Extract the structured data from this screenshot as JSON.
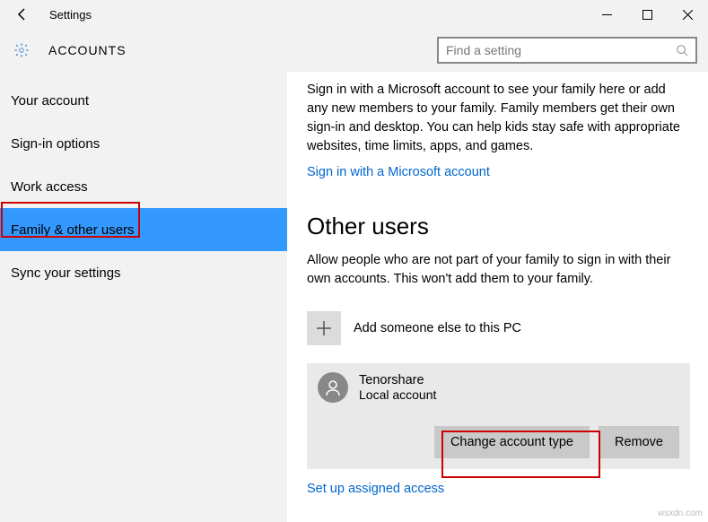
{
  "window": {
    "title": "Settings"
  },
  "header": {
    "section": "ACCOUNTS"
  },
  "search": {
    "placeholder": "Find a setting"
  },
  "sidebar": {
    "items": [
      {
        "label": "Your account"
      },
      {
        "label": "Sign-in options"
      },
      {
        "label": "Work access"
      },
      {
        "label": "Family & other users"
      },
      {
        "label": "Sync your settings"
      }
    ]
  },
  "main": {
    "intro": "Sign in with a Microsoft account to see your family here or add any new members to your family. Family members get their own sign-in and desktop. You can help kids stay safe with appropriate websites, time limits, apps, and games.",
    "signin_link": "Sign in with a Microsoft account",
    "other_users_heading": "Other users",
    "other_users_desc": "Allow people who are not part of your family to sign in with their own accounts. This won't add them to your family.",
    "add_label": "Add someone else to this PC",
    "user": {
      "name": "Tenorshare",
      "type": "Local account"
    },
    "buttons": {
      "change": "Change account type",
      "remove": "Remove"
    },
    "assigned_link": "Set up assigned access"
  },
  "watermark": "wsxdn.com"
}
